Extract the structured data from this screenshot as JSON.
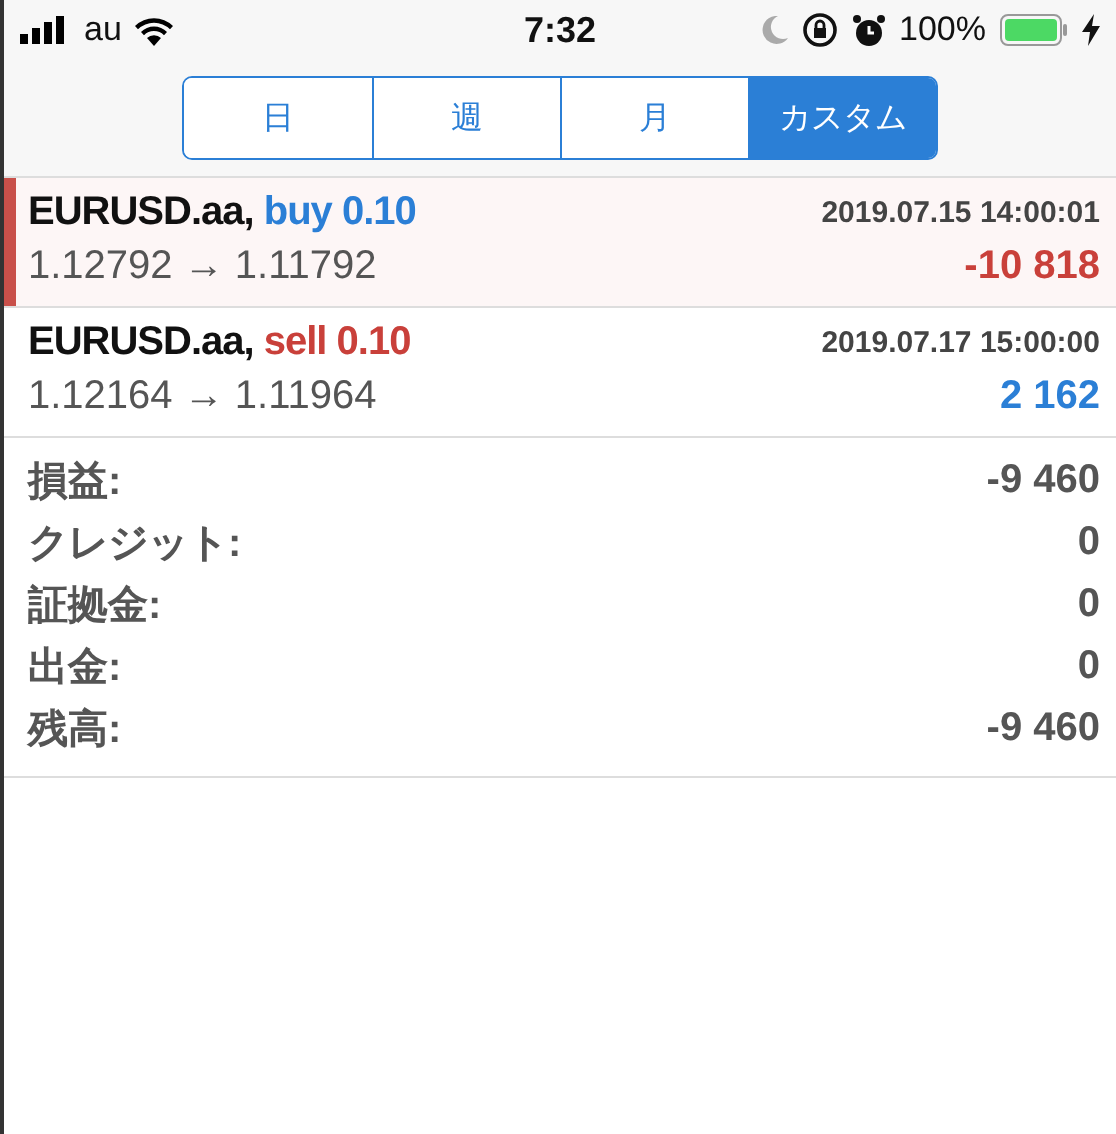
{
  "status_bar": {
    "carrier": "au",
    "time": "7:32",
    "battery": "100%"
  },
  "tabs": [
    {
      "label": "日",
      "selected": false
    },
    {
      "label": "週",
      "selected": false
    },
    {
      "label": "月",
      "selected": false
    },
    {
      "label": "カスタム",
      "selected": true
    }
  ],
  "trades": [
    {
      "symbol": "EURUSD.aa,",
      "order": {
        "text": "buy 0.10",
        "color": "#2b7fd6"
      },
      "time": "2019.07.15 14:00:01",
      "prices": "1.12792 → 1.11792",
      "profit": {
        "text": "-10 818",
        "color": "#c9403a"
      },
      "selected": true
    },
    {
      "symbol": "EURUSD.aa,",
      "order": {
        "text": "sell 0.10",
        "color": "#c9403a"
      },
      "time": "2019.07.17 15:00:00",
      "prices": "1.12164 → 1.11964",
      "profit": {
        "text": "2 162",
        "color": "#2b7fd6"
      },
      "selected": false
    }
  ],
  "summary": [
    {
      "label": "損益:",
      "value": "-9 460"
    },
    {
      "label": "クレジット:",
      "value": "0"
    },
    {
      "label": "証拠金:",
      "value": "0"
    },
    {
      "label": "出金:",
      "value": "0"
    },
    {
      "label": "残高:",
      "value": "-9 460"
    }
  ]
}
